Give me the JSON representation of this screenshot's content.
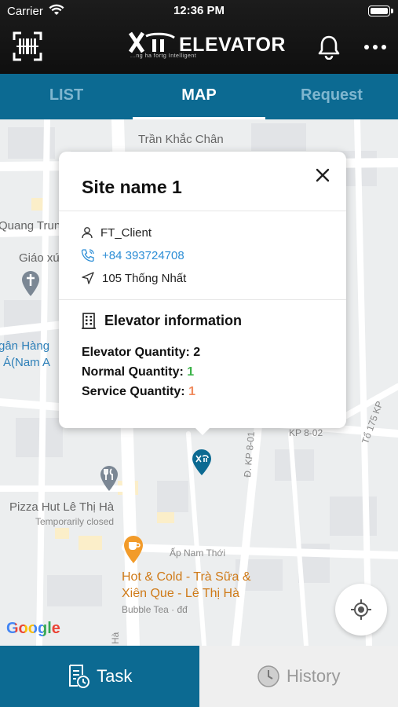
{
  "status_bar": {
    "carrier": "Carrier",
    "time": "12:36 PM"
  },
  "header": {
    "logo_text": "ELEVATOR",
    "logo_tagline": "...ng ha fortg Intelligent"
  },
  "tabs": [
    {
      "label": "LIST",
      "active": false
    },
    {
      "label": "MAP",
      "active": true
    },
    {
      "label": "Request",
      "active": false
    }
  ],
  "map": {
    "labels": {
      "tran_khac_chan": "Trần Khắc Chân",
      "quang_trung": "Quang Trung",
      "giao_xu": "Giáo xứ",
      "ngan_hang": "gân Hàng",
      "nam_a": "Á(Nam A",
      "kp_8_02": "KP 8-02",
      "kp_8_01": "Đ. KP 8-01",
      "to_175": "Tổ 175 KP",
      "pizza_hut": "Pizza Hut Lê Thị Hà",
      "temporarily_closed": "Temporarily closed",
      "ap_nam_thoi": "Ấp Nam Thới",
      "hot_cold_1": "Hot & Cold - Trà Sữa &",
      "hot_cold_2": "Xiên Que - Lê Thị Hà",
      "bubble_tea": "Bubble Tea · đđ",
      "street_ha": "Hà",
      "google": "Google"
    }
  },
  "popup": {
    "site_name": "Site name 1",
    "client": "FT_Client",
    "phone": "+84 393724708",
    "address": "105 Thống Nhất",
    "elevator_section_title": "Elevator information",
    "elevator_quantity_label": "Elevator Quantity:",
    "elevator_quantity_value": "2",
    "normal_quantity_label": "Normal Quantity:",
    "normal_quantity_value": "1",
    "service_quantity_label": "Service Quantity:",
    "service_quantity_value": "1"
  },
  "bottom_tabs": [
    {
      "label": "Task",
      "active": true,
      "icon": "task-icon"
    },
    {
      "label": "History",
      "active": false,
      "icon": "clock-icon"
    }
  ],
  "colors": {
    "primary": "#0c6a92",
    "link": "#2d8ed6",
    "normal_green": "#3cb34a",
    "service_orange": "#f08a5d"
  }
}
